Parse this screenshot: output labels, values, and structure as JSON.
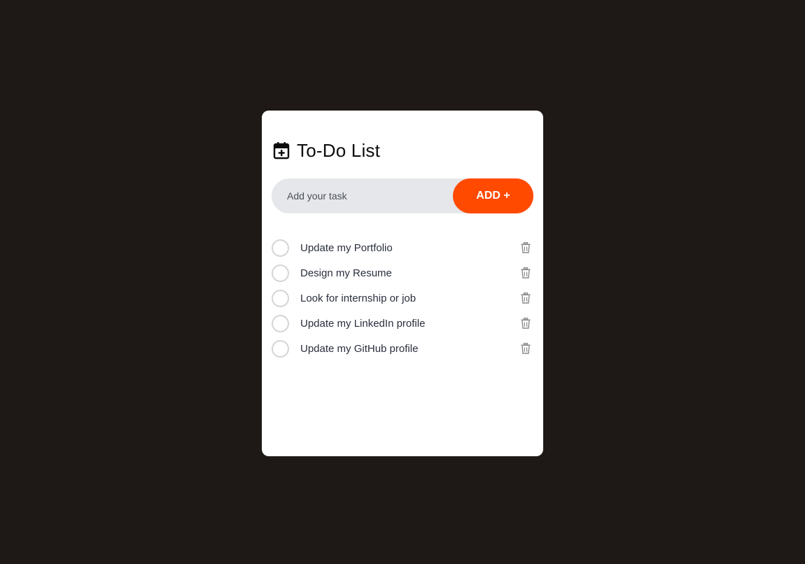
{
  "header": {
    "title": "To-Do List",
    "icon": "calendar-plus-icon"
  },
  "input": {
    "placeholder": "Add your task",
    "value": ""
  },
  "add_button": {
    "label": "ADD +"
  },
  "tasks": [
    {
      "text": "Update my Portfolio",
      "done": false
    },
    {
      "text": "Design my Resume",
      "done": false
    },
    {
      "text": "Look for internship or job",
      "done": false
    },
    {
      "text": "Update my LinkedIn profile",
      "done": false
    },
    {
      "text": "Update my GitHub profile",
      "done": false
    }
  ],
  "colors": {
    "background": "#1e1916",
    "card": "#ffffff",
    "accent": "#ff4a00",
    "input_bg": "#e6e7ea",
    "checkbox_border": "#d5d5d5",
    "delete_icon": "#8a8a8a"
  }
}
